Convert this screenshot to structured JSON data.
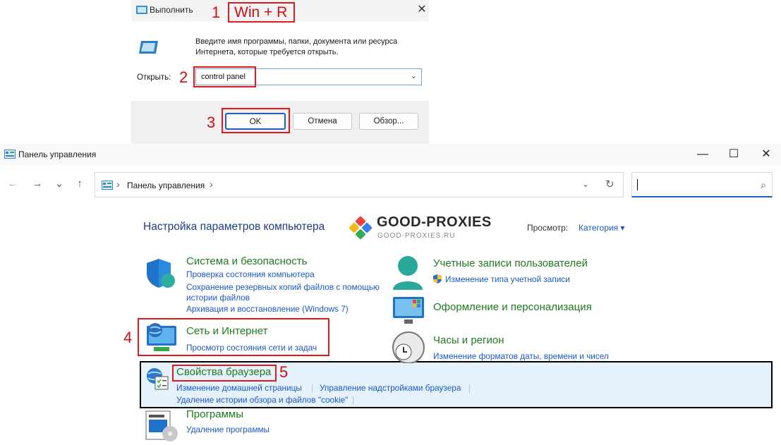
{
  "run_dialog": {
    "title": "Выполнить",
    "close": "✕",
    "description": "Введите имя программы, папки, документа или ресурса Интернета, которые требуется открыть.",
    "open_label": "Открыть:",
    "input_value": "control panel",
    "ok_label": "OK",
    "cancel_label": "Отмена",
    "browse_label": "Обзор..."
  },
  "annotations": {
    "step1": "1",
    "step1_text": "Win + R",
    "step2": "2",
    "step3": "3",
    "step4": "4",
    "step5": "5",
    "color": "#e0191d"
  },
  "control_panel": {
    "title": "Панель управления",
    "window_controls": {
      "minimize": "—",
      "maximize": "☐",
      "close": "✕"
    },
    "nav": {
      "back": "←",
      "forward": "→",
      "recent": "⌄",
      "up": "↑"
    },
    "address": {
      "separator": "›",
      "crumb": "Панель управления",
      "separator2": "›",
      "dropdown": "⌄",
      "refresh": "↻"
    },
    "search": {
      "icon": "⌕"
    },
    "heading": "Настройка параметров компьютера",
    "logo": {
      "word": "GOOD-PROXIES",
      "sub": "GOOD-PROXIES.RU"
    },
    "view_label": "Просмотр:",
    "view_value": "Категория ▾",
    "categories": [
      {
        "title": "Система и безопасность",
        "links": [
          "Проверка состояния компьютера",
          "Сохранение резервных копий файлов с помощью",
          "истории файлов",
          "Архивация и восстановление (Windows 7)"
        ]
      },
      {
        "title": "Сеть и Интернет",
        "links": [
          "Просмотр состояния сети и задач"
        ]
      },
      {
        "title": "Свойства браузера",
        "links": [
          "Изменение домашней страницы",
          "Управление надстройками браузера",
          "Удаление истории обзора и файлов \"cookie\""
        ]
      },
      {
        "title": "Программы",
        "links": [
          "Удаление программы"
        ]
      },
      {
        "title": "Учетные записи пользователей",
        "links": [
          "Изменение типа учетной записи"
        ]
      },
      {
        "title": "Оформление и персонализация",
        "links": []
      },
      {
        "title": "Часы и регион",
        "links": [
          "Изменение форматов даты, времени и чисел"
        ]
      }
    ]
  }
}
